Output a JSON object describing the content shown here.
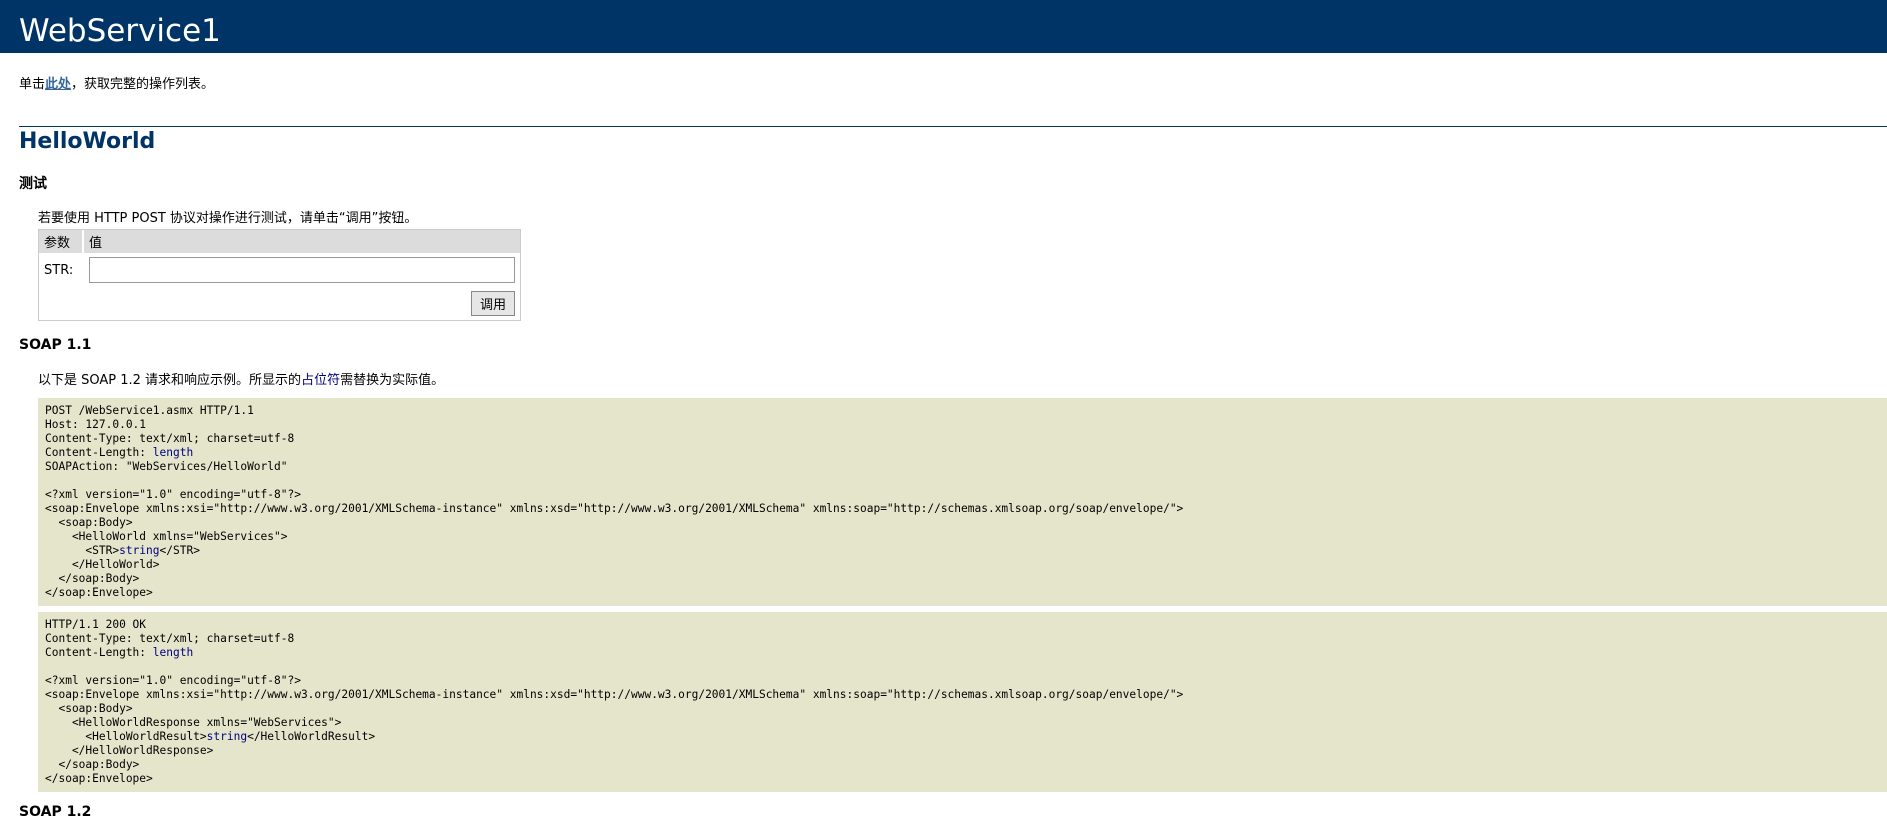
{
  "service": {
    "name": "WebService1"
  },
  "intro": {
    "prefix": "单击",
    "link": "此处",
    "suffix": "，获取完整的操作列表。"
  },
  "operation": {
    "name": "HelloWorld",
    "test": {
      "heading": "测试",
      "description": "若要使用 HTTP POST 协议对操作进行测试，请单击“调用”按钮。",
      "columns": [
        "参数",
        "值"
      ],
      "params": [
        {
          "label": "STR:",
          "value": ""
        }
      ],
      "invoke_label": "调用"
    },
    "soap11": {
      "heading": "SOAP 1.1",
      "desc_prefix": "以下是 SOAP 1.2 请求和响应示例。所显示的",
      "desc_placeholder": "占位符",
      "desc_suffix": "需替换为实际值。",
      "request": {
        "l1": "POST /WebService1.asmx HTTP/1.1",
        "l2": "Host: 127.0.0.1",
        "l3": "Content-Type: text/xml; charset=utf-8",
        "l4_prefix": "Content-Length: ",
        "l4_value": "length",
        "l5": "SOAPAction: \"WebServices/HelloWorld\"",
        "l6": "",
        "l7": "<?xml version=\"1.0\" encoding=\"utf-8\"?>",
        "l8": "<soap:Envelope xmlns:xsi=\"http://www.w3.org/2001/XMLSchema-instance\" xmlns:xsd=\"http://www.w3.org/2001/XMLSchema\" xmlns:soap=\"http://schemas.xmlsoap.org/soap/envelope/\">",
        "l9": "  <soap:Body>",
        "l10": "    <HelloWorld xmlns=\"WebServices\">",
        "l11_open": "      <STR>",
        "l11_value": "string",
        "l11_close": "</STR>",
        "l12": "    </HelloWorld>",
        "l13": "  </soap:Body>",
        "l14": "</soap:Envelope>"
      },
      "response": {
        "l1": "HTTP/1.1 200 OK",
        "l2": "Content-Type: text/xml; charset=utf-8",
        "l3_prefix": "Content-Length: ",
        "l3_value": "length",
        "l4": "",
        "l5": "<?xml version=\"1.0\" encoding=\"utf-8\"?>",
        "l6": "<soap:Envelope xmlns:xsi=\"http://www.w3.org/2001/XMLSchema-instance\" xmlns:xsd=\"http://www.w3.org/2001/XMLSchema\" xmlns:soap=\"http://schemas.xmlsoap.org/soap/envelope/\">",
        "l7": "  <soap:Body>",
        "l8": "    <HelloWorldResponse xmlns=\"WebServices\">",
        "l9_open": "      <HelloWorldResult>",
        "l9_value": "string",
        "l9_close": "</HelloWorldResult>",
        "l10": "    </HelloWorldResponse>",
        "l11": "  </soap:Body>",
        "l12": "</soap:Envelope>"
      }
    },
    "soap12": {
      "heading": "SOAP 1.2"
    }
  },
  "colors": {
    "header_bg": "#003366",
    "code_bg": "#e5e5cc",
    "link": "#336699",
    "placeholder": "#000080"
  }
}
